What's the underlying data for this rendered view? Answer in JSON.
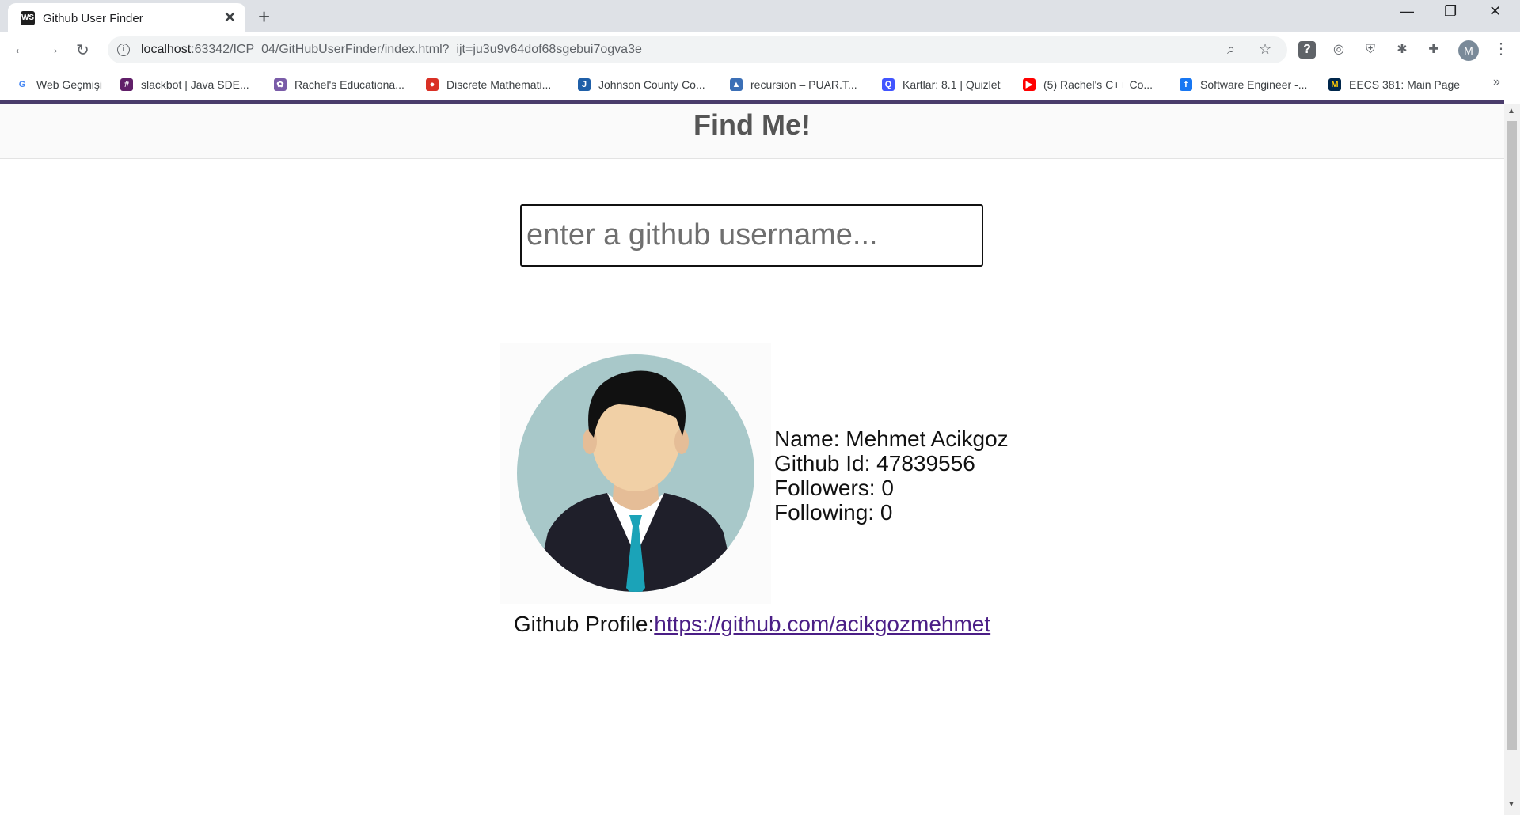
{
  "browser": {
    "tab_title": "Github User Finder",
    "tab_close": "✕",
    "new_tab": "+",
    "window_controls": {
      "minimize": "—",
      "restore": "❐",
      "close": "✕"
    },
    "url_host": "localhost",
    "url_rest": ":63342/ICP_04/GitHubUserFinder/index.html?_ijt=ju3u9v64dof68sgebui7ogva3e",
    "profile_initial": "M",
    "bookmarks": [
      {
        "label": "Web Geçmişi",
        "icon": "G",
        "color": "#ffffff",
        "fg": "#4285f4"
      },
      {
        "label": "slackbot | Java SDE...",
        "icon": "#",
        "color": "#611f69",
        "fg": "#ffffff"
      },
      {
        "label": "Rachel's Educationa...",
        "icon": "✿",
        "color": "#7a5ca8",
        "fg": "#ffffff"
      },
      {
        "label": "Discrete Mathemati...",
        "icon": "●",
        "color": "#d93025",
        "fg": "#ffffff"
      },
      {
        "label": "Johnson County Co...",
        "icon": "J",
        "color": "#1f5fa8",
        "fg": "#ffffff"
      },
      {
        "label": "recursion – PUAR.T...",
        "icon": "▲",
        "color": "#3b6fb6",
        "fg": "#ffffff"
      },
      {
        "label": "Kartlar: 8.1 | Quizlet",
        "icon": "Q",
        "color": "#4255ff",
        "fg": "#ffffff"
      },
      {
        "label": "(5) Rachel's C++ Co...",
        "icon": "▶",
        "color": "#ff0000",
        "fg": "#ffffff"
      },
      {
        "label": "Software Engineer -...",
        "icon": "f",
        "color": "#1877f2",
        "fg": "#ffffff"
      },
      {
        "label": "EECS 381: Main Page",
        "icon": "M",
        "color": "#00274c",
        "fg": "#ffcb05"
      }
    ],
    "bookmarks_more": "»"
  },
  "page": {
    "title": "Find Me!",
    "search_placeholder": "enter a github username...",
    "user": {
      "name_line": "Name: Mehmet Acikgoz",
      "id_line": "Github Id: 47839556",
      "followers_line": "Followers: 0",
      "following_line": "Following: 0"
    },
    "profile_label": "Github Profile:",
    "profile_url": "https://github.com/acikgozmehmet"
  },
  "colors": {
    "accent_bar": "#4a3c6b",
    "link": "#4b1e86",
    "avatar_bg": "#a8c8c9",
    "tie": "#1ba3b8"
  }
}
